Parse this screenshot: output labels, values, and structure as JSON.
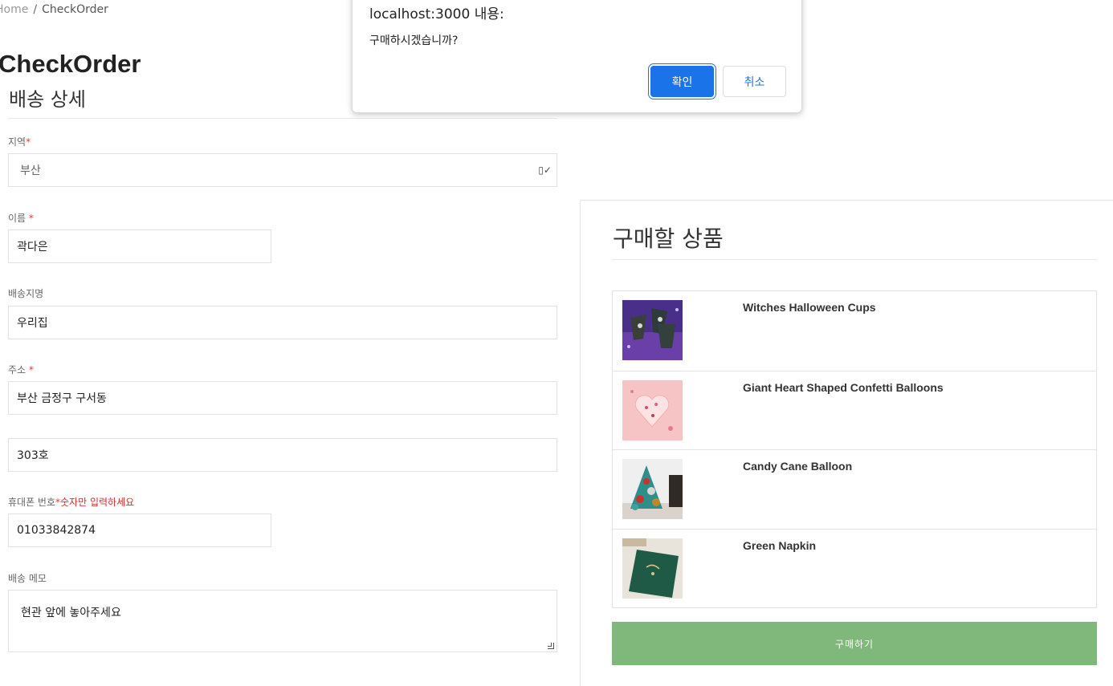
{
  "breadcrumb": {
    "home": "Home",
    "separator": "/",
    "current": "CheckOrder"
  },
  "page_title": "CheckOrder",
  "delivery": {
    "section_title": "배송 상세",
    "region": {
      "label": "지역",
      "required_mark": "*",
      "value": "부산"
    },
    "name": {
      "label": "이름",
      "required_mark": "*",
      "value": "곽다은"
    },
    "place_name": {
      "label": "배송지명",
      "value": "우리집"
    },
    "address": {
      "label": "주소",
      "required_mark": "*",
      "value1": "부산 금정구 구서동",
      "value2": "303호"
    },
    "phone": {
      "label": "휴대폰 번호",
      "required_mark": "*",
      "hint": "숫자만 입력하세요",
      "value": "01033842874"
    },
    "memo": {
      "label": "배송 메모",
      "value": "현관 앞에 놓아주세요"
    }
  },
  "order": {
    "section_title": "구매할 상품",
    "products": [
      {
        "name": "Witches Halloween Cups"
      },
      {
        "name": "Giant Heart Shaped Confetti Balloons"
      },
      {
        "name": "Candy Cane Balloon"
      },
      {
        "name": "Green Napkin"
      }
    ],
    "buy_label": "구매하기"
  },
  "dialog": {
    "title": "localhost:3000 내용:",
    "message": "구매하시겠습니까?",
    "ok_label": "확인",
    "cancel_label": "취소"
  },
  "colors": {
    "buy_button": "#80b77a",
    "dialog_accent": "#1a73e8",
    "required": "#e53935"
  }
}
